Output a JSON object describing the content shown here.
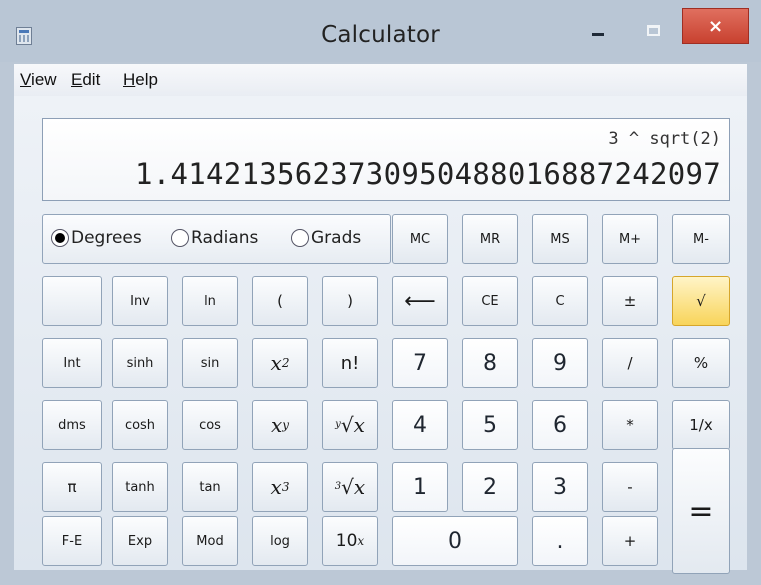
{
  "window": {
    "title": "Calculator",
    "close": "×"
  },
  "menu": {
    "view": {
      "u": "V",
      "rest": "iew"
    },
    "edit": {
      "u": "E",
      "rest": "dit"
    },
    "help": {
      "u": "H",
      "rest": "elp"
    }
  },
  "display": {
    "expression": "3 ^ sqrt(2)",
    "value": "1.4142135623730950488016887242097"
  },
  "angle_modes": {
    "degrees": "Degrees",
    "radians": "Radians",
    "grads": "Grads",
    "selected": "Degrees"
  },
  "buttons": {
    "mc": "MC",
    "mr": "MR",
    "ms": "MS",
    "mplus": "M+",
    "mminus": "M-",
    "inv": "Inv",
    "ln": "ln",
    "lparen": "(",
    "rparen": ")",
    "backspace": "⟵",
    "ce": "CE",
    "c": "C",
    "plusminus": "±",
    "sqrt": "√",
    "int": "Int",
    "sinh": "sinh",
    "sin": "sin",
    "x2_base": "x",
    "x2_exp": "2",
    "fact": "n!",
    "seven": "7",
    "eight": "8",
    "nine": "9",
    "divide": "/",
    "percent": "%",
    "dms": "dms",
    "cosh": "cosh",
    "cos": "cos",
    "xy_base": "x",
    "xy_exp": "y",
    "yroot_label": "∜x",
    "yroot_index": "y",
    "yroot_sign": "√",
    "yroot_x": "x",
    "four": "4",
    "five": "5",
    "six": "6",
    "multiply": "*",
    "reciprocal": "1/x",
    "pi": "π",
    "tanh": "tanh",
    "tan": "tan",
    "x3_base": "x",
    "x3_exp": "3",
    "cuberoot_index": "3",
    "cuberoot_sign": "√",
    "cuberoot_x": "x",
    "one": "1",
    "two": "2",
    "three": "3",
    "minus": "-",
    "equals": "=",
    "fe": "F-E",
    "exp": "Exp",
    "mod": "Mod",
    "log": "log",
    "tenx_base": "10",
    "tenx_exp": "x",
    "zero": "0",
    "decimal": ".",
    "plus": "+"
  },
  "colors": {
    "highlight": "#f8d45a",
    "close_button": "#c8412f",
    "frame": "#b9c6d5"
  }
}
